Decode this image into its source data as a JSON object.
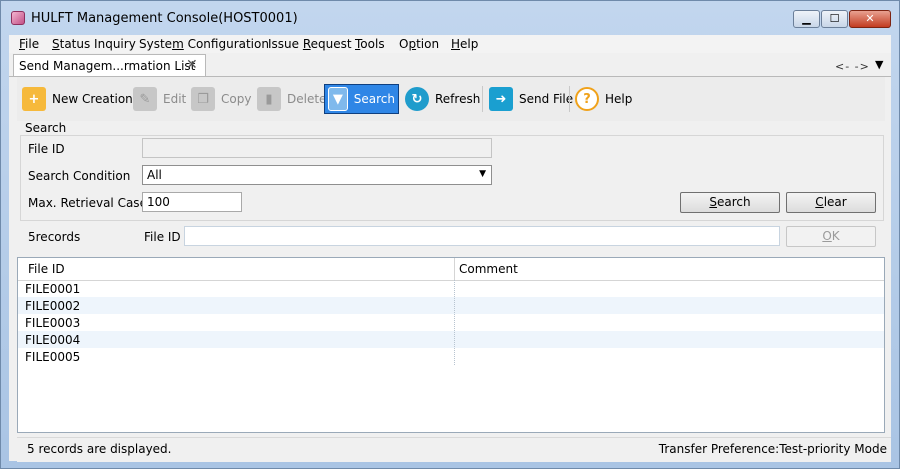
{
  "window": {
    "title": "HULFT Management Console(HOST0001)",
    "min_label": "▁",
    "max_label": "☐",
    "close_label": "✕"
  },
  "menu": [
    {
      "pre": "",
      "u": "F",
      "post": "ile"
    },
    {
      "pre": "",
      "u": "S",
      "post": "tatus Inquiry"
    },
    {
      "pre": "Syste",
      "u": "m",
      "post": " Configuration"
    },
    {
      "pre": "Issue ",
      "u": "R",
      "post": "equest"
    },
    {
      "pre": "",
      "u": "T",
      "post": "ools"
    },
    {
      "pre": "O",
      "u": "p",
      "post": "tion"
    },
    {
      "pre": "",
      "u": "H",
      "post": "elp"
    }
  ],
  "tab": {
    "label": "Send Managem...rmation List",
    "close": "✕",
    "nav_arrows": "<- ->",
    "nav_menu": "▼"
  },
  "toolbar": {
    "new_creation": "New Creation",
    "edit": "Edit",
    "copy": "Copy",
    "delete": "Delete",
    "search": "Search",
    "refresh": "Refresh",
    "send_file": "Send File",
    "help": "Help"
  },
  "search": {
    "legend": "Search",
    "file_id_label": "File ID",
    "file_id_value": "",
    "condition_label": "Search Condition",
    "condition_value": "All",
    "max_label": "Max. Retrieval Cases",
    "max_value": "100",
    "search_button": {
      "pre": "",
      "u": "S",
      "post": "earch"
    },
    "clear_button": {
      "pre": "",
      "u": "C",
      "post": "lear"
    }
  },
  "filter": {
    "records_count": "5records",
    "file_id_label": "File ID",
    "file_id_value": "",
    "ok_button": {
      "pre": "",
      "u": "O",
      "post": "K"
    }
  },
  "table": {
    "columns": [
      "File ID",
      "Comment"
    ],
    "rows": [
      {
        "file_id": "FILE0001",
        "comment": ""
      },
      {
        "file_id": "FILE0002",
        "comment": ""
      },
      {
        "file_id": "FILE0003",
        "comment": ""
      },
      {
        "file_id": "FILE0004",
        "comment": ""
      },
      {
        "file_id": "FILE0005",
        "comment": ""
      }
    ]
  },
  "status": {
    "left": "5 records are displayed.",
    "right": "Transfer Preference:Test-priority Mode"
  }
}
